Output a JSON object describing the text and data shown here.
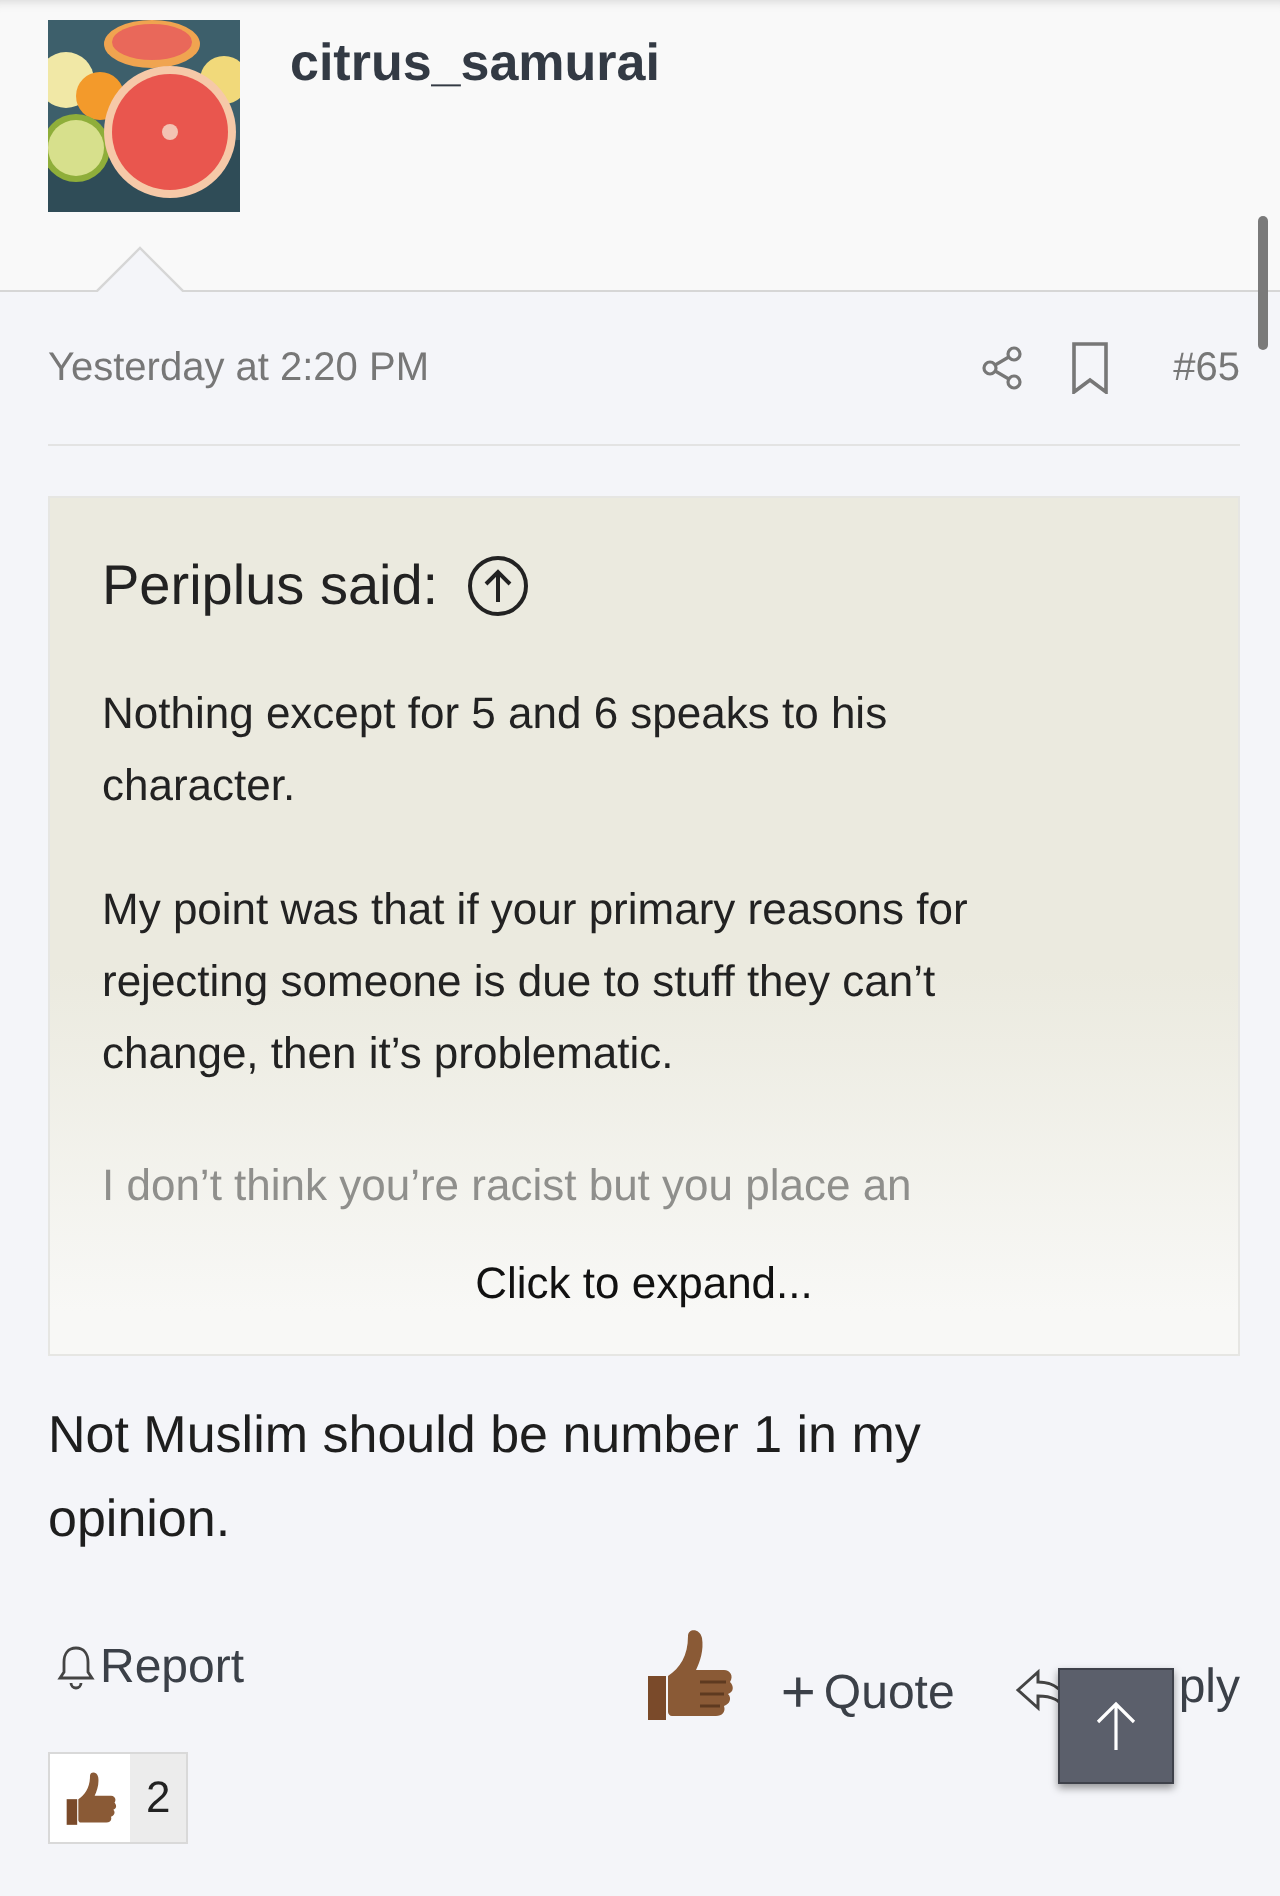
{
  "post": {
    "author": "citrus_samurai",
    "date": "Yesterday at 2:20 PM",
    "number": "#65"
  },
  "quote": {
    "author": "Periplus said:",
    "paragraphs": [
      "Nothing except for 5 and 6 speaks to his character.",
      "My point was that if your primary reasons for rejecting someone is due to stuff they can’t change, then it’s problematic.",
      "I don’t think you’re racist but you place an"
    ],
    "expand": "Click to expand..."
  },
  "body": "Not Muslim should be number 1 in my opinion.",
  "actions": {
    "report": "Report",
    "quote": "Quote",
    "quote_mark": "+",
    "reply": "ply"
  },
  "reactions": [
    {
      "count": "2"
    }
  ]
}
